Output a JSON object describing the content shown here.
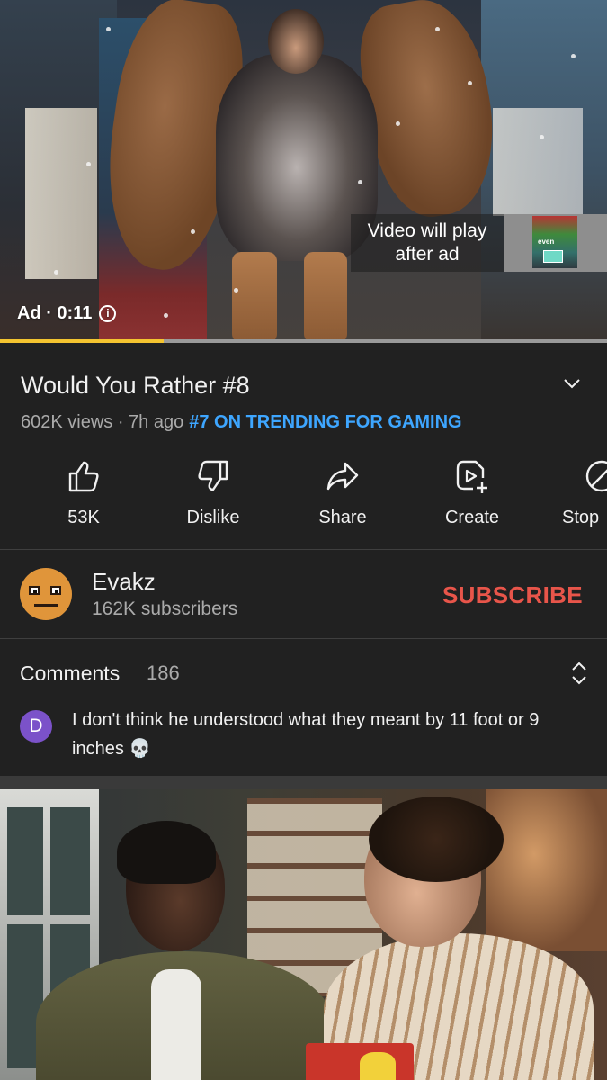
{
  "player": {
    "after_ad_line1": "Video will play",
    "after_ad_line2": "after ad",
    "thumb_tag": "even",
    "ad_label": "Ad · 0:11",
    "progress": 0.27,
    "progress_color": "#f4c430"
  },
  "video": {
    "title": "Would You Rather #8",
    "views": "602K views · 7h ago",
    "trending": "#7 ON TRENDING FOR GAMING"
  },
  "actions": [
    {
      "icon": "like-icon",
      "label": "53K"
    },
    {
      "icon": "dislike-icon",
      "label": "Dislike"
    },
    {
      "icon": "share-icon",
      "label": "Share"
    },
    {
      "icon": "create-icon",
      "label": "Create"
    },
    {
      "icon": "stop-ads-icon",
      "label": "Stop"
    }
  ],
  "channel": {
    "name": "Evakz",
    "subscribers": "162K subscribers",
    "subscribe_label": "SUBSCRIBE",
    "subscribe_color": "#e8554a"
  },
  "comments": {
    "heading": "Comments",
    "count": "186",
    "top_comment": {
      "avatar_letter": "D",
      "avatar_color": "#7b52c9",
      "text": "I don't think he understood what they meant by 11 foot or 9 inches 💀"
    }
  },
  "colors": {
    "background": "#212121",
    "link": "#3ea6ff",
    "secondary_text": "#aaaaaa"
  }
}
